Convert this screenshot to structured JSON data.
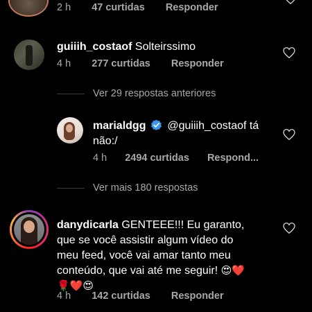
{
  "comment_top": {
    "time": "2 h",
    "likes": "47 curtidas",
    "reply_label": "Responder"
  },
  "comment1": {
    "username": "guiiih_costaof",
    "text": "Solteirssimo",
    "time": "4 h",
    "likes": "277 curtidas",
    "reply_label": "Responder"
  },
  "view_previous": "Ver 29 respostas anteriores",
  "reply1": {
    "username": "marialdgg",
    "verified": true,
    "text_line1": "@guiiih_costaof tá",
    "text_line2": "não:/",
    "time": "4 h",
    "likes": "2494 curtidas",
    "reply_label": "Respond..."
  },
  "view_more": "Ver mais 180 respostas",
  "comment2": {
    "username": "danydicarla",
    "text_line1": "GENTEEE!!! Eu garanto,",
    "text_line2": "que se você assistir algum vídeo do",
    "text_line3": "meu feed, você vai amar tanto meu",
    "text_line4": "conteúdo, que vai até me seguir!",
    "emoji_line4": "😍❤️",
    "emoji_line5": "🌹❤️😍",
    "time": "4 h",
    "likes": "142 curtidas",
    "reply_label": "Responder"
  },
  "colors": {
    "background": "#000000",
    "secondary_text": "#a8a8a8",
    "verified_badge": "#3897f0"
  }
}
